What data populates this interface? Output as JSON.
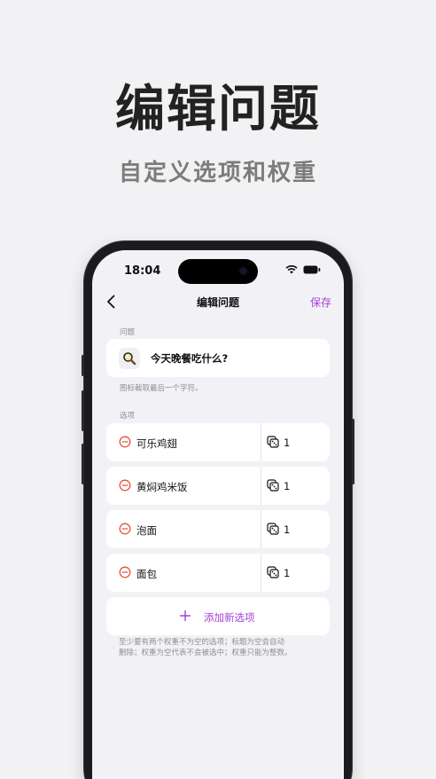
{
  "promo": {
    "headline": "编辑问题",
    "subhead": "自定义选项和权重"
  },
  "status_bar": {
    "time": "18:04",
    "icons": [
      "wifi-icon",
      "battery-icon"
    ]
  },
  "nav": {
    "back_icon": "chevron-left-icon",
    "title": "编辑问题",
    "save_label": "保存"
  },
  "question": {
    "section_label": "问题",
    "icon": "magnifying-glass-icon",
    "text": "今天晚餐吃什么?",
    "hint": "图标截取最后一个字符。"
  },
  "options": {
    "section_label": "选项",
    "items": [
      {
        "label": "可乐鸡翅",
        "weight": "1"
      },
      {
        "label": "黄焖鸡米饭",
        "weight": "1"
      },
      {
        "label": "泡面",
        "weight": "1"
      },
      {
        "label": "面包",
        "weight": "1"
      }
    ],
    "add_label": "添加新选项",
    "footnote_line1": "至少要有两个权重不为空的选项；标题为空会自动",
    "footnote_line2": "删除；权重为空代表不会被选中；权重只能为整数。"
  },
  "colors": {
    "accent": "#a640d9",
    "remove": "#e5533c"
  }
}
